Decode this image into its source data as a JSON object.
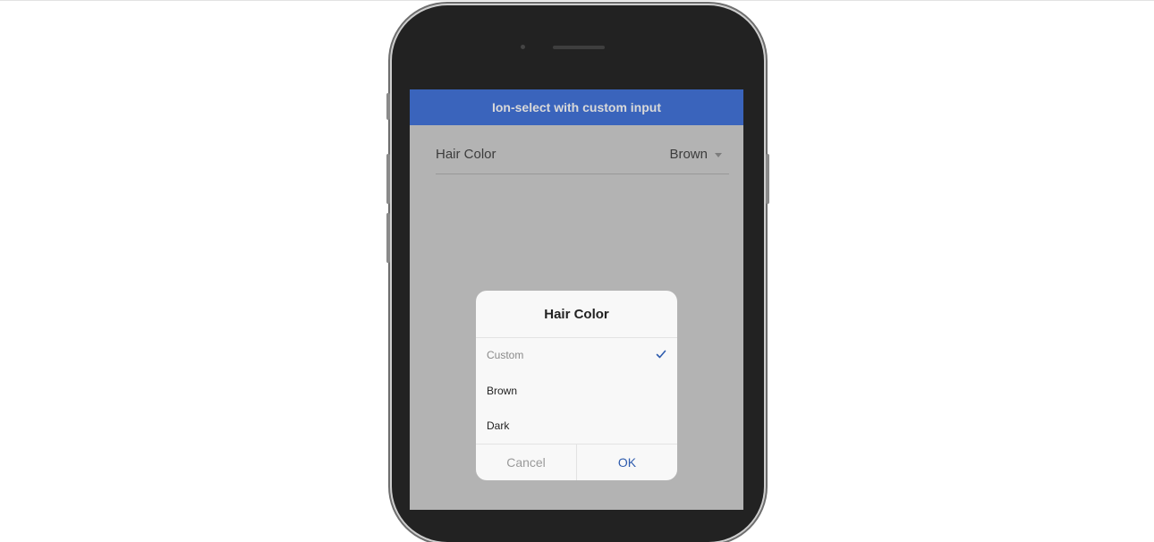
{
  "toolbar": {
    "title": "Ion-select with custom input"
  },
  "item": {
    "label": "Hair Color",
    "value": "Brown"
  },
  "alert": {
    "title": "Hair Color",
    "options": [
      {
        "label": "Custom",
        "checked": true
      },
      {
        "label": "Brown",
        "checked": false
      },
      {
        "label": "Dark",
        "checked": false
      }
    ],
    "buttons": {
      "cancel": "Cancel",
      "ok": "OK"
    }
  },
  "colors": {
    "toolbar": "#3a64bc",
    "backdrop": "#b3b3b3",
    "primary": "#2f5cae"
  },
  "icons": {
    "check": "checkmark-icon",
    "dropdown": "caret-down-icon"
  }
}
